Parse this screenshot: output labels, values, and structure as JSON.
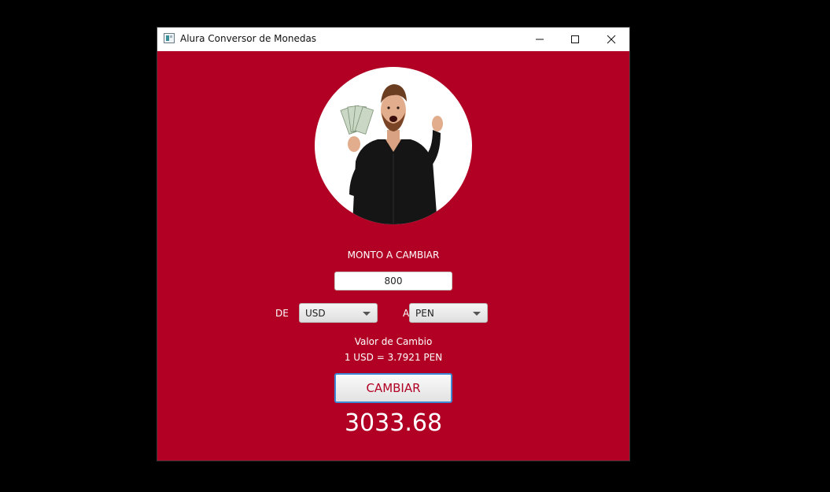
{
  "window": {
    "title": "Alura Conversor de Monedas"
  },
  "form": {
    "amount_label": "MONTO A CAMBIAR",
    "amount_value": "800",
    "from_label": "DE",
    "from_currency": "USD",
    "to_label": "A",
    "to_currency": "PEN",
    "rate_title": "Valor de Cambio",
    "rate_value": "1 USD = 3.7921 PEN",
    "convert_label": "CAMBIAR",
    "result": "3033.68"
  },
  "icons": {
    "app": "app-window-icon",
    "minimize": "minimize-icon",
    "maximize": "maximize-icon",
    "close": "close-icon",
    "dropdown": "chevron-down-icon"
  },
  "colors": {
    "background": "#b10024",
    "text": "#ffffff",
    "button_text": "#b10024",
    "focus_border": "#3d89d6"
  }
}
